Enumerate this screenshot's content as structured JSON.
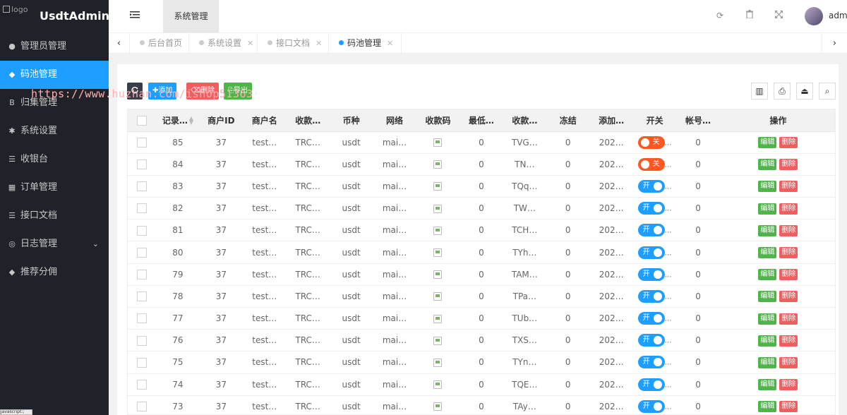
{
  "app": {
    "title": "UsdtAdmin",
    "logo_alt": "logo"
  },
  "sidebar": {
    "items": [
      {
        "label": "管理员管理",
        "icon": "user-icon",
        "glyph": "●"
      },
      {
        "label": "码池管理",
        "icon": "android-icon",
        "glyph": "◆",
        "active": true
      },
      {
        "label": "归集管理",
        "icon": "bitcoin-icon",
        "glyph": "B"
      },
      {
        "label": "系统设置",
        "icon": "asterisk-icon",
        "glyph": "✱"
      },
      {
        "label": "收银台",
        "icon": "list-icon",
        "glyph": "☰"
      },
      {
        "label": "订单管理",
        "icon": "calculator-icon",
        "glyph": "▦"
      },
      {
        "label": "接口文档",
        "icon": "list-icon",
        "glyph": "☰"
      },
      {
        "label": "日志管理",
        "icon": "globe-icon",
        "glyph": "◎",
        "has_children": true
      },
      {
        "label": "推荐分佣",
        "icon": "android-icon",
        "glyph": "◆"
      }
    ]
  },
  "header": {
    "top_tab": "系统管理",
    "admin_name": "admi"
  },
  "tabs": [
    {
      "label": "后台首页",
      "closable": false
    },
    {
      "label": "系统设置",
      "closable": true
    },
    {
      "label": "接口文档",
      "closable": true
    },
    {
      "label": "码池管理",
      "closable": true,
      "active": true
    }
  ],
  "toolbar": {
    "add": "添加",
    "delete": "删除",
    "export": "导出"
  },
  "watermark": "https://www.huzhan.com/ishop51363",
  "table": {
    "columns": [
      "",
      "记录…",
      "商户ID",
      "商户名",
      "收款…",
      "币种",
      "网络",
      "收款码",
      "最低…",
      "收款…",
      "冻结",
      "添加…",
      "开关",
      "帐号…",
      "操作"
    ],
    "switch_on": "开",
    "switch_off": "关",
    "edit": "编辑",
    "delete": "删除",
    "rows": [
      {
        "id": "85",
        "merchant_id": "37",
        "merchant": "test…",
        "chain": "TRC…",
        "coin": "usdt",
        "network": "mai…",
        "min": "0",
        "address": "TVG…",
        "frozen": "0",
        "added": "202…",
        "enabled": false,
        "acct": "0"
      },
      {
        "id": "84",
        "merchant_id": "37",
        "merchant": "test…",
        "chain": "TRC…",
        "coin": "usdt",
        "network": "mai…",
        "min": "0",
        "address": "TN…",
        "frozen": "0",
        "added": "202…",
        "enabled": false,
        "acct": "0"
      },
      {
        "id": "83",
        "merchant_id": "37",
        "merchant": "test…",
        "chain": "TRC…",
        "coin": "usdt",
        "network": "mai…",
        "min": "0",
        "address": "TQq…",
        "frozen": "0",
        "added": "202…",
        "enabled": true,
        "acct": "0"
      },
      {
        "id": "82",
        "merchant_id": "37",
        "merchant": "test…",
        "chain": "TRC…",
        "coin": "usdt",
        "network": "mai…",
        "min": "0",
        "address": "TW…",
        "frozen": "0",
        "added": "202…",
        "enabled": true,
        "acct": "0"
      },
      {
        "id": "81",
        "merchant_id": "37",
        "merchant": "test…",
        "chain": "TRC…",
        "coin": "usdt",
        "network": "mai…",
        "min": "0",
        "address": "TCH…",
        "frozen": "0",
        "added": "202…",
        "enabled": true,
        "acct": "0"
      },
      {
        "id": "80",
        "merchant_id": "37",
        "merchant": "test…",
        "chain": "TRC…",
        "coin": "usdt",
        "network": "mai…",
        "min": "0",
        "address": "TYh…",
        "frozen": "0",
        "added": "202…",
        "enabled": true,
        "acct": "0"
      },
      {
        "id": "79",
        "merchant_id": "37",
        "merchant": "test…",
        "chain": "TRC…",
        "coin": "usdt",
        "network": "mai…",
        "min": "0",
        "address": "TAM…",
        "frozen": "0",
        "added": "202…",
        "enabled": true,
        "acct": "0"
      },
      {
        "id": "78",
        "merchant_id": "37",
        "merchant": "test…",
        "chain": "TRC…",
        "coin": "usdt",
        "network": "mai…",
        "min": "0",
        "address": "TPa…",
        "frozen": "0",
        "added": "202…",
        "enabled": true,
        "acct": "0"
      },
      {
        "id": "77",
        "merchant_id": "37",
        "merchant": "test…",
        "chain": "TRC…",
        "coin": "usdt",
        "network": "mai…",
        "min": "0",
        "address": "TUb…",
        "frozen": "0",
        "added": "202…",
        "enabled": true,
        "acct": "0"
      },
      {
        "id": "76",
        "merchant_id": "37",
        "merchant": "test…",
        "chain": "TRC…",
        "coin": "usdt",
        "network": "mai…",
        "min": "0",
        "address": "TXS…",
        "frozen": "0",
        "added": "202…",
        "enabled": true,
        "acct": "0"
      },
      {
        "id": "75",
        "merchant_id": "37",
        "merchant": "test…",
        "chain": "TRC…",
        "coin": "usdt",
        "network": "mai…",
        "min": "0",
        "address": "TYn…",
        "frozen": "0",
        "added": "202…",
        "enabled": true,
        "acct": "0"
      },
      {
        "id": "74",
        "merchant_id": "37",
        "merchant": "test…",
        "chain": "TRC…",
        "coin": "usdt",
        "network": "mai…",
        "min": "0",
        "address": "TQE…",
        "frozen": "0",
        "added": "202…",
        "enabled": true,
        "acct": "0"
      },
      {
        "id": "73",
        "merchant_id": "37",
        "merchant": "test…",
        "chain": "TRC…",
        "coin": "usdt",
        "network": "mai…",
        "min": "0",
        "address": "TAy…",
        "frozen": "0",
        "added": "202…",
        "enabled": true,
        "acct": "0"
      }
    ]
  },
  "statusbar": "javascript:;",
  "colors": {
    "sidebar": "#20222a",
    "accent": "#1e9fff",
    "add": "#1e9fff",
    "delete": "#f25d5d",
    "export": "#4fb54a",
    "switch_off": "#ff5722"
  }
}
